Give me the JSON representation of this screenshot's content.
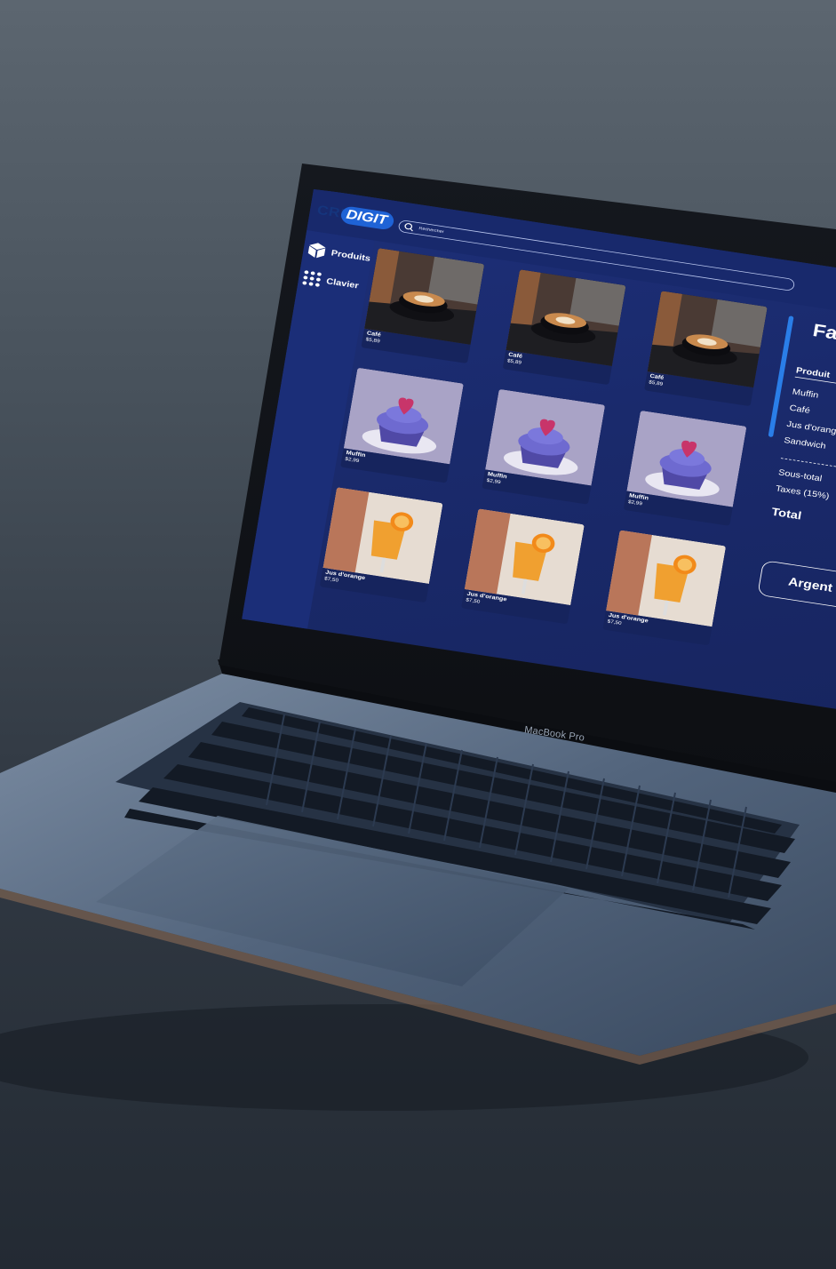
{
  "device": {
    "label": "MacBook Pro"
  },
  "app": {
    "logo": {
      "part1": "CRI",
      "part2": "DIGIT"
    },
    "search": {
      "placeholder": "Rechercher"
    },
    "sidebar": {
      "items": [
        {
          "label": "Produits",
          "icon": "cube-icon"
        },
        {
          "label": "Clavier",
          "icon": "keypad-icon"
        }
      ]
    },
    "products": [
      {
        "name": "Café",
        "price": "$5,89",
        "kind": "coffee"
      },
      {
        "name": "Café",
        "price": "$5,89",
        "kind": "coffee"
      },
      {
        "name": "Café",
        "price": "$5,89",
        "kind": "coffee"
      },
      {
        "name": "Muffin",
        "price": "$2,99",
        "kind": "muffin"
      },
      {
        "name": "Muffin",
        "price": "$2,99",
        "kind": "muffin"
      },
      {
        "name": "Muffin",
        "price": "$2,99",
        "kind": "muffin"
      },
      {
        "name": "Jus d'orange",
        "price": "$7,50",
        "kind": "juice"
      },
      {
        "name": "Jus d'orange",
        "price": "$7,50",
        "kind": "juice"
      },
      {
        "name": "Jus d'orange",
        "price": "$7,50",
        "kind": "juice"
      }
    ],
    "invoice": {
      "title": "Fac",
      "column_header": "Produit",
      "lines": [
        "Muffin",
        "Café",
        "Jus d'orang",
        "Sandwich"
      ],
      "subtotal_label": "Sous-total",
      "tax_label": "Taxes (15%)",
      "total_label": "Total",
      "pay_button": "Argent"
    }
  },
  "colors": {
    "screen_bg": "#1a2a6c",
    "accent": "#2a7ee8",
    "card_bg": "#16245d"
  }
}
